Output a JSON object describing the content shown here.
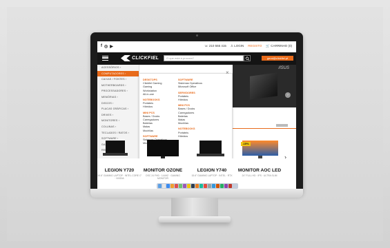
{
  "topbar": {
    "social": [
      "f",
      "◎",
      "▶"
    ],
    "phone": "☏ 210 555 415",
    "login": "♙ LOGIN",
    "register": "REGISTO",
    "cart": "🛒 CARRINHO (0)"
  },
  "header": {
    "logo": "CLICKFIEL",
    "search_placeholder": "O que está à procura?",
    "email": "geral@clickfiel.pt"
  },
  "sidebar": {
    "items": [
      {
        "label": "ACESSÓRIOS ›",
        "active": false
      },
      {
        "label": "COMPUTADORES ›",
        "active": true
      },
      {
        "label": "CAIXAS / FONTES ›",
        "active": false
      },
      {
        "label": "MOTHERBOARDS ›",
        "active": false
      },
      {
        "label": "PROCESSADORES ›",
        "active": false
      },
      {
        "label": "MEMÓRIAS ›",
        "active": false
      },
      {
        "label": "DISCOS ›",
        "active": false
      },
      {
        "label": "PLACAS GRÁFICAS ›",
        "active": false
      },
      {
        "label": "DRIVES ›",
        "active": false
      },
      {
        "label": "MONITORES ›",
        "active": false
      },
      {
        "label": "COLUNAS ›",
        "active": false
      },
      {
        "label": "TECLADOS / RATOS ›",
        "active": false
      },
      {
        "label": "SOFTWARE ›",
        "active": false
      },
      {
        "label": "GAMING ›",
        "active": false
      },
      {
        "label": "REDES ›",
        "active": false
      }
    ]
  },
  "megamenu": {
    "close": "×",
    "col1": [
      {
        "h": "DESKTOPS"
      },
      {
        "t": "Clickfiel Gaming"
      },
      {
        "t": "Gaming"
      },
      {
        "t": "Workstation"
      },
      {
        "t": "All-in-one"
      },
      {
        "gap": true
      },
      {
        "h": "NOTEBOOKS"
      },
      {
        "t": "Portáteis"
      },
      {
        "t": "Híbridos"
      },
      {
        "gap": true
      },
      {
        "h": "MINI PCS"
      },
      {
        "t": "Bases / Docks"
      },
      {
        "t": "Carregadores"
      },
      {
        "t": "Baterias"
      },
      {
        "t": "Malas"
      },
      {
        "t": "Mochilas"
      },
      {
        "gap": true
      },
      {
        "h": "SOFTWARE"
      },
      {
        "t": "Sistemas Operativos"
      },
      {
        "t": "Microsoft Office"
      }
    ],
    "col2": [
      {
        "h": "SOFTWARE"
      },
      {
        "t": "Sistemas Operativos"
      },
      {
        "t": "Microsoft Office"
      },
      {
        "gap": true
      },
      {
        "h": "SERVIDORES"
      },
      {
        "t": "Portáteis"
      },
      {
        "t": "Híbridos"
      },
      {
        "gap": true
      },
      {
        "h": "MINI PCS"
      },
      {
        "t": "Bases / Docks"
      },
      {
        "t": "Carregadores"
      },
      {
        "t": "Baterias"
      },
      {
        "t": "Malas"
      },
      {
        "t": "Mochilas"
      },
      {
        "gap": true
      },
      {
        "h": "NOTEBOOKS"
      },
      {
        "t": "Portáteis"
      },
      {
        "t": "Híbridos"
      }
    ]
  },
  "banner": {
    "brand": "/ISUS",
    "next": "›"
  },
  "products": [
    {
      "title": "LEGION Y720",
      "sub": "15.6\" GAMING LAPTOP · INTEL CORE I7 · NVIDIA"
    },
    {
      "title": "MONITOR OZONE",
      "sub": "DSC 24 FHD · 144HZ · GAMING MONITOR"
    },
    {
      "title": "LEGION Y740",
      "sub": "15.6\" GAMING LAPTOP · INTEL · RTX"
    },
    {
      "title": "MONITOR AOC LED",
      "sub": "24\" FULL HD · IPS · ULTRA SLIM"
    }
  ],
  "discount": "-15%",
  "products_next": "›",
  "colors": {
    "accent": "#e86a1a",
    "header": "#141414"
  }
}
